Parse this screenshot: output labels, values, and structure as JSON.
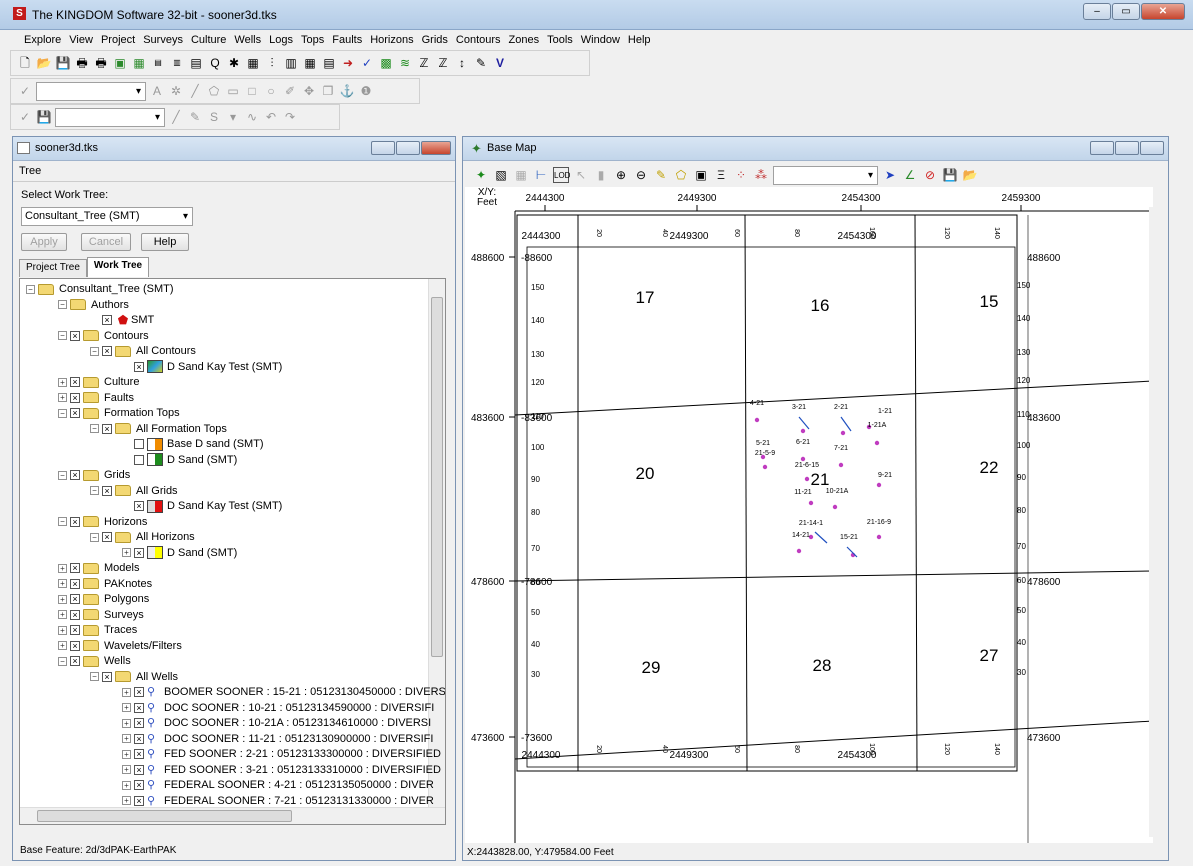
{
  "app": {
    "title": "The KINGDOM Software 32-bit - sooner3d.tks",
    "icon_letter": "S"
  },
  "menu": [
    "Explore",
    "View",
    "Project",
    "Surveys",
    "Culture",
    "Wells",
    "Logs",
    "Tops",
    "Faults",
    "Horizons",
    "Grids",
    "Contours",
    "Zones",
    "Tools",
    "Window",
    "Help"
  ],
  "tree_panel": {
    "title": "sooner3d.tks",
    "menu": "Tree",
    "select_label": "Select Work Tree:",
    "select_value": "Consultant_Tree (SMT)",
    "apply": "Apply",
    "cancel": "Cancel",
    "help": "Help",
    "tab_project": "Project Tree",
    "tab_work": "Work Tree",
    "status": "Base Feature: 2d/3dPAK-EarthPAK",
    "nodes": [
      {
        "label": "Consultant_Tree (SMT)",
        "indent": 0,
        "exp": "−",
        "chk": false,
        "icon": "folder"
      },
      {
        "label": "Authors",
        "indent": 1,
        "exp": "−",
        "chk": false,
        "icon": "folder"
      },
      {
        "label": "SMT",
        "indent": 2,
        "exp": "",
        "chk": true,
        "icon": "author"
      },
      {
        "label": "Contours",
        "indent": 1,
        "exp": "−",
        "chk": true,
        "icon": "folder"
      },
      {
        "label": "All Contours",
        "indent": 2,
        "exp": "−",
        "chk": true,
        "icon": "folder"
      },
      {
        "label": "D Sand Kay Test (SMT)",
        "indent": 3,
        "exp": "",
        "chk": true,
        "icon": "contour"
      },
      {
        "label": "Culture",
        "indent": 1,
        "exp": "+",
        "chk": true,
        "icon": "folder"
      },
      {
        "label": "Faults",
        "indent": 1,
        "exp": "+",
        "chk": true,
        "icon": "folder"
      },
      {
        "label": "Formation Tops",
        "indent": 1,
        "exp": "−",
        "chk": true,
        "icon": "folder"
      },
      {
        "label": "All Formation Tops",
        "indent": 2,
        "exp": "−",
        "chk": true,
        "icon": "folder"
      },
      {
        "label": "Base D sand (SMT)",
        "indent": 3,
        "exp": "",
        "chk": "empty",
        "icon": "top-orange"
      },
      {
        "label": "D Sand (SMT)",
        "indent": 3,
        "exp": "",
        "chk": "empty",
        "icon": "top-green"
      },
      {
        "label": "Grids",
        "indent": 1,
        "exp": "−",
        "chk": true,
        "icon": "folder"
      },
      {
        "label": "All Grids",
        "indent": 2,
        "exp": "−",
        "chk": true,
        "icon": "folder"
      },
      {
        "label": "D Sand Kay Test (SMT)",
        "indent": 3,
        "exp": "",
        "chk": true,
        "icon": "grid-red"
      },
      {
        "label": "Horizons",
        "indent": 1,
        "exp": "−",
        "chk": true,
        "icon": "folder"
      },
      {
        "label": "All Horizons",
        "indent": 2,
        "exp": "−",
        "chk": true,
        "icon": "folder"
      },
      {
        "label": "D Sand (SMT)",
        "indent": 3,
        "exp": "+",
        "chk": true,
        "icon": "horizon-yellow"
      },
      {
        "label": "Models",
        "indent": 1,
        "exp": "+",
        "chk": true,
        "icon": "folder"
      },
      {
        "label": "PAKnotes",
        "indent": 1,
        "exp": "+",
        "chk": true,
        "icon": "folder"
      },
      {
        "label": "Polygons",
        "indent": 1,
        "exp": "+",
        "chk": true,
        "icon": "folder"
      },
      {
        "label": "Surveys",
        "indent": 1,
        "exp": "+",
        "chk": true,
        "icon": "folder"
      },
      {
        "label": "Traces",
        "indent": 1,
        "exp": "+",
        "chk": true,
        "icon": "folder"
      },
      {
        "label": "Wavelets/Filters",
        "indent": 1,
        "exp": "+",
        "chk": true,
        "icon": "folder"
      },
      {
        "label": "Wells",
        "indent": 1,
        "exp": "−",
        "chk": true,
        "icon": "folder"
      },
      {
        "label": "All Wells",
        "indent": 2,
        "exp": "−",
        "chk": true,
        "icon": "folder"
      },
      {
        "label": "BOOMER SOONER : 15-21 : 05123130450000 : DIVERS",
        "indent": 3,
        "exp": "+",
        "chk": true,
        "icon": "well"
      },
      {
        "label": "DOC SOONER : 10-21 : 05123134590000 : DIVERSIFI",
        "indent": 3,
        "exp": "+",
        "chk": true,
        "icon": "well"
      },
      {
        "label": "DOC SOONER : 10-21A : 05123134610000 : DIVERSI",
        "indent": 3,
        "exp": "+",
        "chk": true,
        "icon": "well"
      },
      {
        "label": "DOC SOONER : 11-21 : 05123130900000 : DIVERSIFI",
        "indent": 3,
        "exp": "+",
        "chk": true,
        "icon": "well"
      },
      {
        "label": "FED SOONER : 2-21 : 05123133300000 : DIVERSIFIED",
        "indent": 3,
        "exp": "+",
        "chk": true,
        "icon": "well"
      },
      {
        "label": "FED SOONER : 3-21 : 05123133310000 : DIVERSIFIED",
        "indent": 3,
        "exp": "+",
        "chk": true,
        "icon": "well"
      },
      {
        "label": "FEDERAL SOONER : 4-21 : 05123135050000 : DIVER",
        "indent": 3,
        "exp": "+",
        "chk": true,
        "icon": "well"
      },
      {
        "label": "FEDERAL SOONER : 7-21 : 05123131330000 : DIVER",
        "indent": 3,
        "exp": "+",
        "chk": true,
        "icon": "well"
      }
    ]
  },
  "basemap": {
    "title": "Base Map",
    "xy_label": "X/Y:",
    "unit_label": "Feet",
    "status": "X:2443828.00, Y:479584.00 Feet",
    "x_ticks_outer": [
      "2444300",
      "2449300",
      "2454300",
      "2459300"
    ],
    "y_ticks_outer": [
      "488600",
      "483600",
      "478600",
      "473600"
    ],
    "x_ticks_inner": [
      "2444300",
      "2449300",
      "2454300"
    ],
    "y_ticks_inner": [
      "-88600",
      "-83600",
      "-78600",
      "-73600"
    ],
    "y_ticks_inner_right": [
      "488600",
      "483600",
      "478600",
      "473600"
    ],
    "y_ticks_inner_right_prefix": "-",
    "sections": [
      "17",
      "16",
      "15",
      "20",
      "21",
      "22",
      "29",
      "28",
      "27"
    ],
    "wells": [
      "4-21",
      "3-21",
      "2-21",
      "1-21",
      "1-21A",
      "5-21",
      "21-5-9",
      "6-21",
      "7-21",
      "21-6-15",
      "9-21",
      "11-21",
      "10-21A",
      "21-14-1",
      "14-21",
      "15-21",
      "21-16-9"
    ],
    "left_scale": [
      "150",
      "140",
      "130",
      "120",
      "110",
      "100",
      "90",
      "80",
      "70",
      "60",
      "50",
      "40",
      "30"
    ],
    "top_scale": [
      "20",
      "30",
      "40",
      "50",
      "60",
      "70",
      "80",
      "90",
      "100",
      "110",
      "120",
      "130",
      "140"
    ]
  },
  "colors": {
    "well_marker": "#c03cc0",
    "grid_red": "#e11010",
    "top_orange": "#f08c00",
    "top_green": "#1e8c1e",
    "horizon_yellow": "#ffff00"
  }
}
